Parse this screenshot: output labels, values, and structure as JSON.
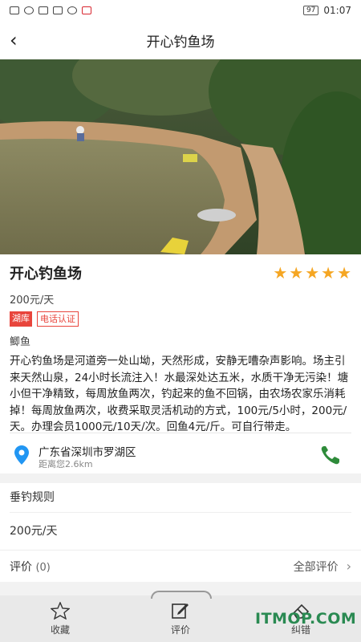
{
  "status": {
    "battery": "97",
    "time": "01:07"
  },
  "nav": {
    "title": "开心钓鱼场"
  },
  "spot": {
    "name": "开心钓鱼场",
    "rating": 5,
    "price": "200元/天",
    "tags": [
      "湖库",
      "电话认证"
    ],
    "fish": "鲫鱼",
    "description": "开心钓鱼场是河道旁一处山坳，天然形成，安静无嘈杂声影响。场主引来天然山泉，24小时长流注入！水最深处达五米，水质干净无污染！塘小但干净精致，每周放鱼两次，钓起来的鱼不回锅，由农场农家乐消耗掉！每周放鱼两次，收费采取灵活机动的方式，100元/5小时，200元/天。办理会员1000元/10天/次。回鱼4元/斤。可自行带走。"
  },
  "location": {
    "address": "广东省深圳市罗湖区",
    "distance": "距离您2.6km"
  },
  "rules": {
    "title": "垂钓规则",
    "value": "200元/天"
  },
  "reviews": {
    "label": "评价",
    "count": "(0)",
    "all_label": "全部评价"
  },
  "tabbar": {
    "favorite": "收藏",
    "review": "评价",
    "correct": "纠错"
  },
  "watermark": "ITMOP.COM",
  "colors": {
    "star": "#f5a623",
    "tag": "#e8453c",
    "phone": "#2e8b3a",
    "pin": "#2196f3"
  }
}
